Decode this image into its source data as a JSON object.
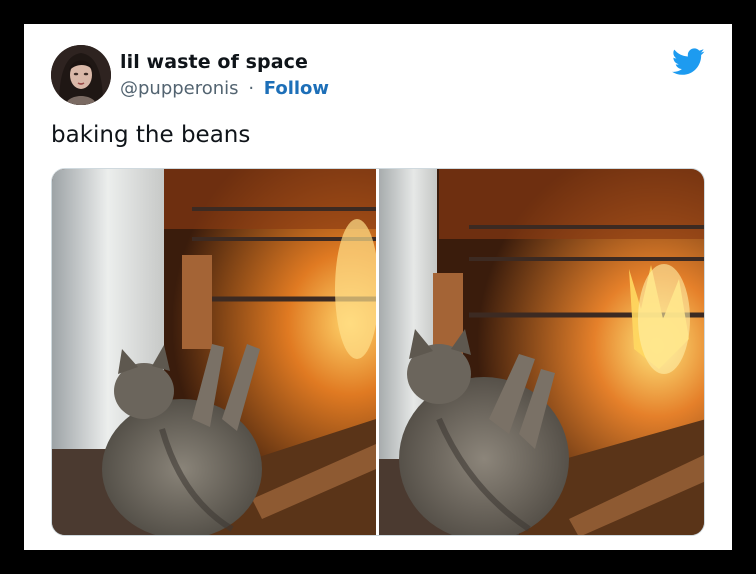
{
  "tweet": {
    "display_name": "lil waste of space",
    "handle": "@pupperonis",
    "separator": "·",
    "follow_label": "Follow",
    "text": "baking the beans",
    "logo_icon": "twitter-bird-icon",
    "brand_color": "#1d9bf0",
    "follow_color": "#1d6fb8",
    "media_count": 2
  }
}
